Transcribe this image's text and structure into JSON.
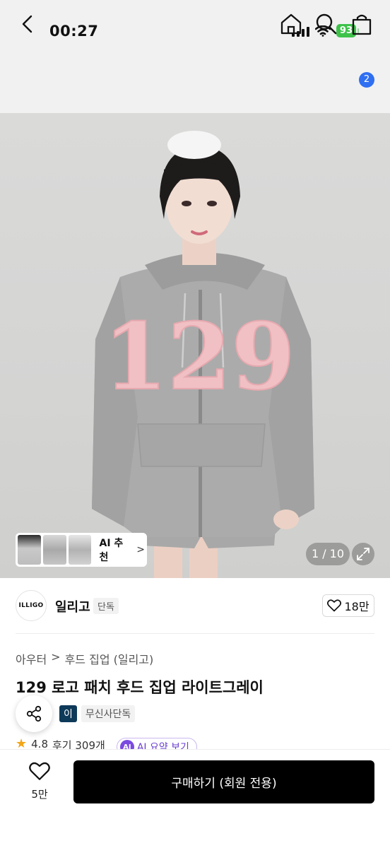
{
  "status_bar": {
    "time": "00:27",
    "battery": "93"
  },
  "nav": {
    "cart_count": "2"
  },
  "hero": {
    "ai_recommend_label": "AI 추천",
    "image_counter": "1 / 10",
    "print_text": "129"
  },
  "brand": {
    "logo_text": "ILLIGO",
    "name": "일리고",
    "tag": "단독",
    "likes": "18만"
  },
  "product": {
    "breadcrumb": [
      "아우터",
      "후드 집업 (일리고)"
    ],
    "breadcrumb_sep": ">",
    "title": "129 로고 패치 후드 집업 라이트그레이",
    "tag_dark": "이",
    "tag_exclusive": "무신사단독",
    "rating": "4.8",
    "reviews": "후기 309개",
    "ai_badge": "AI",
    "ai_summary": "AI 요약 보기"
  },
  "bottom": {
    "wish_count": "5만",
    "buy_label": "구매하기 (회원 전용)"
  },
  "colors": {
    "accent": "#2f6ff2",
    "battery": "#3ec24a",
    "buy_bg": "#000000",
    "ai_purple": "#7a4be0",
    "star": "#f2a516"
  }
}
